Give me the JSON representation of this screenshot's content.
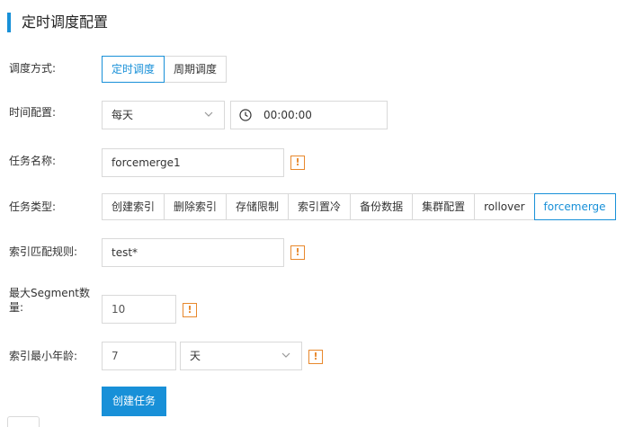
{
  "section": {
    "title": "定时调度配置"
  },
  "schedule_mode": {
    "label": "调度方式:",
    "options": [
      "定时调度",
      "周期调度"
    ],
    "active": 0
  },
  "time_config": {
    "label": "时间配置:",
    "frequency": "每天",
    "time": "00:00:00"
  },
  "task_name": {
    "label": "任务名称:",
    "value": "forcemerge1"
  },
  "task_type": {
    "label": "任务类型:",
    "options": [
      "创建索引",
      "删除索引",
      "存储限制",
      "索引置冷",
      "备份数据",
      "集群配置",
      "rollover",
      "forcemerge"
    ],
    "active": 7
  },
  "index_pattern": {
    "label": "索引匹配规则:",
    "value": "test*"
  },
  "max_segment": {
    "label": "最大Segment数量:",
    "value": "10"
  },
  "min_index_age": {
    "label": "索引最小年龄:",
    "value": "7",
    "unit": "天"
  },
  "actions": {
    "create_label": "创建任务"
  },
  "warn_glyph": "!",
  "colors": {
    "accent": "#1890d8",
    "warning": "#e8882c",
    "border": "#d9d9d9"
  }
}
